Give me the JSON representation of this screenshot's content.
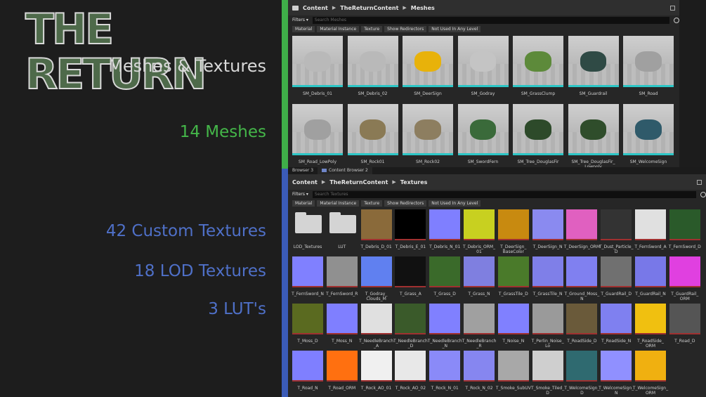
{
  "left": {
    "title": "THE RETURN",
    "subtitle": "Meshes & Textures",
    "meshes": "14 Meshes",
    "custom": "42 Custom Textures",
    "lod": "18 LOD Textures",
    "luts": "3   LUT's"
  },
  "meshes_panel": {
    "crumbs": [
      "Content",
      "TheReturnContent",
      "Meshes"
    ],
    "filters": "Filters ▾",
    "search_placeholder": "Search Meshes",
    "tags": [
      "Material",
      "Material Instance",
      "Texture",
      "Show Redirectors",
      "Not Used In Any Level"
    ],
    "items": [
      {
        "name": "SM_Debris_01",
        "color": "#b9b9b9"
      },
      {
        "name": "SM_Debris_02",
        "color": "#b9b9b9"
      },
      {
        "name": "SM_DeerSign",
        "color": "#e8b20a"
      },
      {
        "name": "SM_Godray",
        "color": "#c4c4c4"
      },
      {
        "name": "SM_GrassClump",
        "color": "#5d8a3a"
      },
      {
        "name": "SM_Guardrail",
        "color": "#2f4a45"
      },
      {
        "name": "SM_Road",
        "color": "#a0a0a0"
      },
      {
        "name": "SM_Road_LowPoly",
        "color": "#a0a0a0"
      },
      {
        "name": "SM_Rock01",
        "color": "#8a7a55"
      },
      {
        "name": "SM_Rock02",
        "color": "#8d7e60"
      },
      {
        "name": "SM_SwordFern",
        "color": "#3a6a3a"
      },
      {
        "name": "SM_Tree_DouglasFir",
        "color": "#2d4a2a"
      },
      {
        "name": "SM_Tree_DouglasFir_\nLowpoly",
        "color": "#2f4d2b"
      },
      {
        "name": "SM_WelcomeSign",
        "color": "#2f5a6a"
      }
    ]
  },
  "tabs": [
    "Browser 3",
    "Content Browser 2"
  ],
  "textures_panel": {
    "crumbs": [
      "Content",
      "TheReturnContent",
      "Textures"
    ],
    "filters": "Filters ▾",
    "search_placeholder": "Search Textures",
    "tags": [
      "Material",
      "Material Instance",
      "Texture",
      "Show Redirectors",
      "Not Used In Any Level"
    ],
    "items": [
      {
        "name": "LOD_Textures",
        "folder": true
      },
      {
        "name": "LUT",
        "folder": true
      },
      {
        "name": "T_Debris_D_01",
        "color": "#8a6a3a"
      },
      {
        "name": "T_Debris_E_01",
        "color": "#000000"
      },
      {
        "name": "T_Debris_N_01",
        "color": "#7f7fff"
      },
      {
        "name": "T_Debris_ORM_\n01",
        "color": "#c8d020"
      },
      {
        "name": "T_DeerSign_\nBaseColor",
        "color": "#c88a10"
      },
      {
        "name": "T_DeerSign_N",
        "color": "#8a8af0"
      },
      {
        "name": "T_DeerSign_ORM",
        "color": "#e060c0"
      },
      {
        "name": "T_Dust_Particle_\nD",
        "color": "#333333"
      },
      {
        "name": "T_FernSword_A",
        "color": "#e0e0e0"
      },
      {
        "name": "T_FernSword_D",
        "color": "#2a5a2a"
      },
      {
        "name": "T_FernSword_N",
        "color": "#8080ff"
      },
      {
        "name": "T_FernSword_R",
        "color": "#909090"
      },
      {
        "name": "T_Godray_\nClouds_M",
        "color": "#6080f0"
      },
      {
        "name": "T_Grass_A",
        "color": "#111111"
      },
      {
        "name": "T_Grass_D",
        "color": "#3a6a2a"
      },
      {
        "name": "T_Grass_N",
        "color": "#7f7fe0"
      },
      {
        "name": "T_GrassTile_D",
        "color": "#4a7a2a"
      },
      {
        "name": "T_GrassTile_N",
        "color": "#7f7fe8"
      },
      {
        "name": "T_Ground_Moss_\nN",
        "color": "#8080f0"
      },
      {
        "name": "T_GuardRail_D",
        "color": "#707070"
      },
      {
        "name": "T_GuardRail_N",
        "color": "#7878e8"
      },
      {
        "name": "T_GuardRail_\nORM",
        "color": "#e040e0"
      },
      {
        "name": "T_Moss_D",
        "color": "#5a6a20"
      },
      {
        "name": "T_Moss_N",
        "color": "#7f7fff"
      },
      {
        "name": "T_NeedleBranch\n_A",
        "color": "#e0e0e0"
      },
      {
        "name": "T_NeedleBranch\n_D",
        "color": "#3a5a2a"
      },
      {
        "name": "T_NeedleBranch\n_N",
        "color": "#8080ff"
      },
      {
        "name": "T_NeedleBranch\n_R",
        "color": "#a0a0a0"
      },
      {
        "name": "T_Noise_N",
        "color": "#8080ff"
      },
      {
        "name": "T_Perlin_Noise_\nLo",
        "color": "#9a9a9a"
      },
      {
        "name": "T_RoadSide_D",
        "color": "#6a5a3a"
      },
      {
        "name": "T_RoadSide_N",
        "color": "#7f80f0"
      },
      {
        "name": "T_RoadSide_\nORM",
        "color": "#f0c010"
      },
      {
        "name": "T_Road_D",
        "color": "#555555"
      },
      {
        "name": "T_Road_N",
        "color": "#7f7fff"
      },
      {
        "name": "T_Road_ORM",
        "color": "#ff7010"
      },
      {
        "name": "T_Rock_AO_01",
        "color": "#f0f0f0"
      },
      {
        "name": "T_Rock_AO_02",
        "color": "#e8e8e8"
      },
      {
        "name": "T_Rock_N_01",
        "color": "#8a8af8"
      },
      {
        "name": "T_Rock_N_02",
        "color": "#8686f0"
      },
      {
        "name": "T_Smoke_SubUV",
        "color": "#a8a8a8"
      },
      {
        "name": "T_Smoke_Tiled_\nD",
        "color": "#cfcfcf"
      },
      {
        "name": "T_WelcomeSign_\nD",
        "color": "#2f6a70"
      },
      {
        "name": "T_WelcomeSign_\nN",
        "color": "#9090ff"
      },
      {
        "name": "T_WelcomeSign_\nORM",
        "color": "#f0b010"
      }
    ]
  }
}
